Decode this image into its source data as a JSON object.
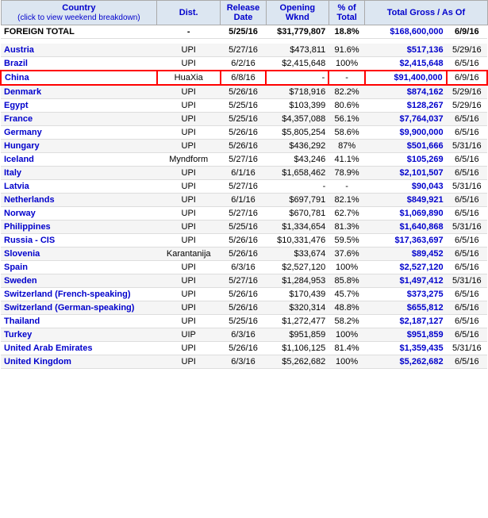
{
  "header": {
    "country_label": "Country",
    "country_sub": "(click to view weekend breakdown)",
    "dist_label": "Dist.",
    "release_label": "Release\nDate",
    "opening_label": "Opening\nWknd",
    "pct_label": "% of\nTotal",
    "total_gross_label": "Total Gross / As Of"
  },
  "rows": [
    {
      "country": "FOREIGN TOTAL",
      "dist": "-",
      "release": "5/25/16",
      "opening": "$31,779,807",
      "pct": "18.8%",
      "total": "$168,600,000",
      "asof": "6/9/16",
      "is_total": true,
      "is_china": false
    },
    {
      "separator": true
    },
    {
      "country": "Austria",
      "dist": "UPI",
      "release": "5/27/16",
      "opening": "$473,811",
      "pct": "91.6%",
      "total": "$517,136",
      "asof": "5/29/16",
      "is_total": false,
      "is_china": false
    },
    {
      "country": "Brazil",
      "dist": "UPI",
      "release": "6/2/16",
      "opening": "$2,415,648",
      "pct": "100%",
      "total": "$2,415,648",
      "asof": "6/5/16",
      "is_total": false,
      "is_china": false
    },
    {
      "country": "China",
      "dist": "HuaXia",
      "release": "6/8/16",
      "opening": "-",
      "pct": "-",
      "total": "$91,400,000",
      "asof": "6/9/16",
      "is_total": false,
      "is_china": true
    },
    {
      "country": "Denmark",
      "dist": "UPI",
      "release": "5/26/16",
      "opening": "$718,916",
      "pct": "82.2%",
      "total": "$874,162",
      "asof": "5/29/16",
      "is_total": false,
      "is_china": false
    },
    {
      "country": "Egypt",
      "dist": "UPI",
      "release": "5/25/16",
      "opening": "$103,399",
      "pct": "80.6%",
      "total": "$128,267",
      "asof": "5/29/16",
      "is_total": false,
      "is_china": false
    },
    {
      "country": "France",
      "dist": "UPI",
      "release": "5/25/16",
      "opening": "$4,357,088",
      "pct": "56.1%",
      "total": "$7,764,037",
      "asof": "6/5/16",
      "is_total": false,
      "is_china": false
    },
    {
      "country": "Germany",
      "dist": "UPI",
      "release": "5/26/16",
      "opening": "$5,805,254",
      "pct": "58.6%",
      "total": "$9,900,000",
      "asof": "6/5/16",
      "is_total": false,
      "is_china": false
    },
    {
      "country": "Hungary",
      "dist": "UPI",
      "release": "5/26/16",
      "opening": "$436,292",
      "pct": "87%",
      "total": "$501,666",
      "asof": "5/31/16",
      "is_total": false,
      "is_china": false
    },
    {
      "country": "Iceland",
      "dist": "Myndform",
      "release": "5/27/16",
      "opening": "$43,246",
      "pct": "41.1%",
      "total": "$105,269",
      "asof": "6/5/16",
      "is_total": false,
      "is_china": false
    },
    {
      "country": "Italy",
      "dist": "UPI",
      "release": "6/1/16",
      "opening": "$1,658,462",
      "pct": "78.9%",
      "total": "$2,101,507",
      "asof": "6/5/16",
      "is_total": false,
      "is_china": false
    },
    {
      "country": "Latvia",
      "dist": "UPI",
      "release": "5/27/16",
      "opening": "-",
      "pct": "-",
      "total": "$90,043",
      "asof": "5/31/16",
      "is_total": false,
      "is_china": false
    },
    {
      "country": "Netherlands",
      "dist": "UPI",
      "release": "6/1/16",
      "opening": "$697,791",
      "pct": "82.1%",
      "total": "$849,921",
      "asof": "6/5/16",
      "is_total": false,
      "is_china": false
    },
    {
      "country": "Norway",
      "dist": "UPI",
      "release": "5/27/16",
      "opening": "$670,781",
      "pct": "62.7%",
      "total": "$1,069,890",
      "asof": "6/5/16",
      "is_total": false,
      "is_china": false
    },
    {
      "country": "Philippines",
      "dist": "UPI",
      "release": "5/25/16",
      "opening": "$1,334,654",
      "pct": "81.3%",
      "total": "$1,640,868",
      "asof": "5/31/16",
      "is_total": false,
      "is_china": false
    },
    {
      "country": "Russia - CIS",
      "dist": "UPI",
      "release": "5/26/16",
      "opening": "$10,331,476",
      "pct": "59.5%",
      "total": "$17,363,697",
      "asof": "6/5/16",
      "is_total": false,
      "is_china": false
    },
    {
      "country": "Slovenia",
      "dist": "Karantanija",
      "release": "5/26/16",
      "opening": "$33,674",
      "pct": "37.6%",
      "total": "$89,452",
      "asof": "6/5/16",
      "is_total": false,
      "is_china": false
    },
    {
      "country": "Spain",
      "dist": "UPI",
      "release": "6/3/16",
      "opening": "$2,527,120",
      "pct": "100%",
      "total": "$2,527,120",
      "asof": "6/5/16",
      "is_total": false,
      "is_china": false
    },
    {
      "country": "Sweden",
      "dist": "UPI",
      "release": "5/27/16",
      "opening": "$1,284,953",
      "pct": "85.8%",
      "total": "$1,497,412",
      "asof": "5/31/16",
      "is_total": false,
      "is_china": false
    },
    {
      "country": "Switzerland (French-speaking)",
      "dist": "UPI",
      "release": "5/26/16",
      "opening": "$170,439",
      "pct": "45.7%",
      "total": "$373,275",
      "asof": "6/5/16",
      "is_total": false,
      "is_china": false
    },
    {
      "country": "Switzerland (German-speaking)",
      "dist": "UPI",
      "release": "5/26/16",
      "opening": "$320,314",
      "pct": "48.8%",
      "total": "$655,812",
      "asof": "6/5/16",
      "is_total": false,
      "is_china": false
    },
    {
      "country": "Thailand",
      "dist": "UPI",
      "release": "5/25/16",
      "opening": "$1,272,477",
      "pct": "58.2%",
      "total": "$2,187,127",
      "asof": "6/5/16",
      "is_total": false,
      "is_china": false
    },
    {
      "country": "Turkey",
      "dist": "UIP",
      "release": "6/3/16",
      "opening": "$951,859",
      "pct": "100%",
      "total": "$951,859",
      "asof": "6/5/16",
      "is_total": false,
      "is_china": false
    },
    {
      "country": "United Arab Emirates",
      "dist": "UPI",
      "release": "5/26/16",
      "opening": "$1,106,125",
      "pct": "81.4%",
      "total": "$1,359,435",
      "asof": "5/31/16",
      "is_total": false,
      "is_china": false
    },
    {
      "country": "United Kingdom",
      "dist": "UPI",
      "release": "6/3/16",
      "opening": "$5,262,682",
      "pct": "100%",
      "total": "$5,262,682",
      "asof": "6/5/16",
      "is_total": false,
      "is_china": false
    }
  ]
}
